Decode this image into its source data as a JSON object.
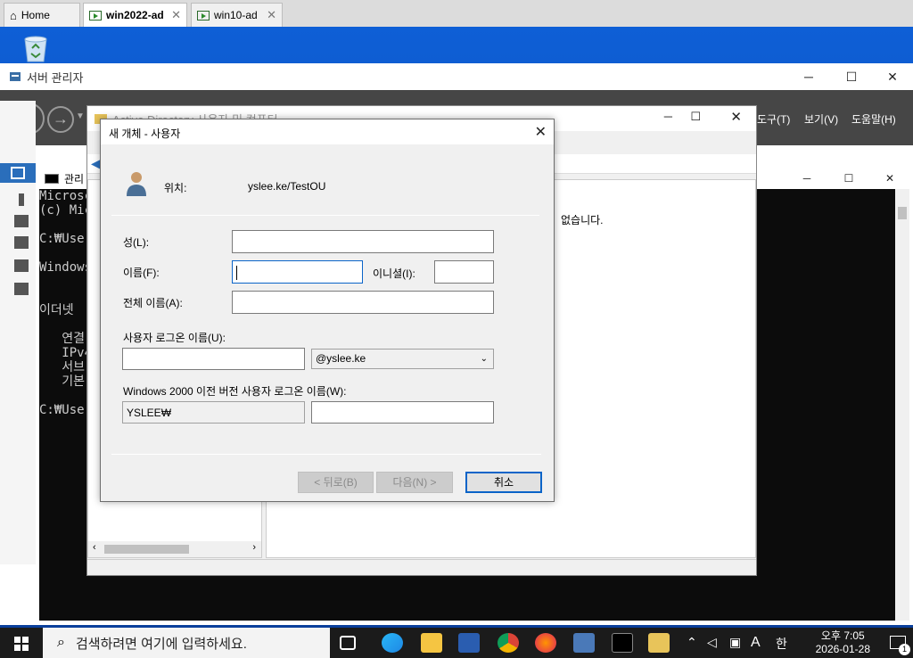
{
  "vm_tabs": [
    {
      "label": "Home",
      "icon": "home-icon"
    },
    {
      "label": "win2022-ad",
      "icon": "vm-icon"
    },
    {
      "label": "win10-ad",
      "icon": "vm-icon"
    }
  ],
  "server_manager": {
    "title": "서버 관리자",
    "menu": [
      "도구(T)",
      "보기(V)",
      "도움말(H)"
    ]
  },
  "ad_window": {
    "title": "Active Directory 사용자 및 컴퓨터",
    "right_text": "없습니다."
  },
  "console": {
    "title": "관리",
    "lines": [
      "Microsc",
      "(c) Mic",
      "",
      "C:₩User",
      "",
      "Windows",
      "",
      "",
      "이더넷",
      "",
      "   연결",
      "   IPv4",
      "   서브",
      "   기본",
      "",
      "C:₩User"
    ]
  },
  "dialog": {
    "title": "새 개체 - 사용자",
    "location_label": "위치:",
    "location_value": "yslee.ke/TestOU",
    "last_name_label": "성(L):",
    "last_name_value": "",
    "first_name_label": "이름(F):",
    "first_name_value": "",
    "initials_label": "이니셜(I):",
    "initials_value": "",
    "full_name_label": "전체 이름(A):",
    "full_name_value": "",
    "logon_label": "사용자 로그온 이름(U):",
    "logon_value": "",
    "domain_suffix": "@yslee.ke",
    "pre2000_label": "Windows 2000 이전 버전 사용자 로그온 이름(W):",
    "pre2000_domain": "YSLEE₩",
    "pre2000_value": "",
    "back_button": "< 뒤로(B)",
    "next_button": "다음(N) >",
    "cancel_button": "취소"
  },
  "taskbar": {
    "search_placeholder": "검색하려면 여기에 입력하세요.",
    "time": "오후 7:05",
    "date": "2026-01-28",
    "ime_mode": "A",
    "ime_lang": "한",
    "notification_count": "1"
  },
  "colors": {
    "accent": "#0a64c8",
    "desktop": "#0e5fd6",
    "toolbar": "#464646",
    "taskbar": "#1b1b1b"
  }
}
